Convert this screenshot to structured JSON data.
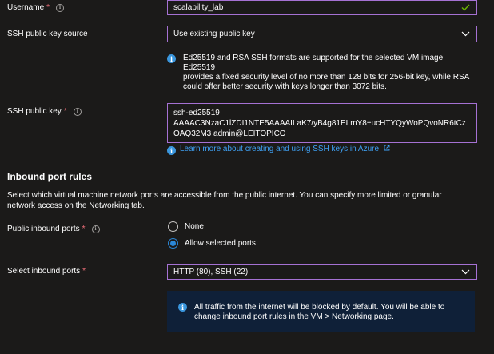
{
  "username": {
    "label": "Username",
    "required_mark": "*",
    "value": "scalability_lab"
  },
  "ssh_key_source": {
    "label": "SSH public key source",
    "value": "Use existing public key",
    "note_lines": [
      "Ed25519 and RSA SSH formats are supported for the selected VM image. Ed25519",
      "provides a fixed security level of no more than 128 bits for 256-bit key, while RSA",
      "could offer better security with keys longer than 3072 bits."
    ]
  },
  "ssh_public_key": {
    "label": "SSH public key",
    "required_mark": "*",
    "value_lines": [
      "ssh-ed25519",
      "AAAAC3NzaC1lZDI1NTE5AAAAILaK7/yB4g81ELmY8+ucHTYQyWoPQvoNR6tCz",
      "OAQ32M3 admin@LEITOPICO"
    ],
    "learn_more_link": "Learn more about creating and using SSH keys in Azure"
  },
  "inbound_rules": {
    "title": "Inbound port rules",
    "description_lines": [
      "Select which virtual machine network ports are accessible from the public internet. You can specify more limited or granular",
      "network access on the Networking tab."
    ],
    "public_ports": {
      "label": "Public inbound ports",
      "required_mark": "*",
      "options": [
        "None",
        "Allow selected ports"
      ],
      "selected": "Allow selected ports"
    },
    "select_ports": {
      "label": "Select inbound ports",
      "required_mark": "*",
      "value": "HTTP (80), SSH (22)"
    },
    "info_lines": [
      "All traffic from the internet will be blocked by default. You will be able to",
      "change inbound port rules in the VM > Networking page."
    ]
  },
  "colors": {
    "background": "#1b1a19",
    "field_border": "#a571d3",
    "required": "#f1707b",
    "info_blue": "#3a96dd",
    "link": "#3fa2f6",
    "radio_selected": "#2b88d8",
    "infobox_bg": "#0f2038",
    "checkmark": "#6bb700"
  },
  "icons": {
    "info": "info-icon",
    "check": "checkmark-icon",
    "chevron": "chevron-down-icon",
    "external": "external-link-icon"
  }
}
